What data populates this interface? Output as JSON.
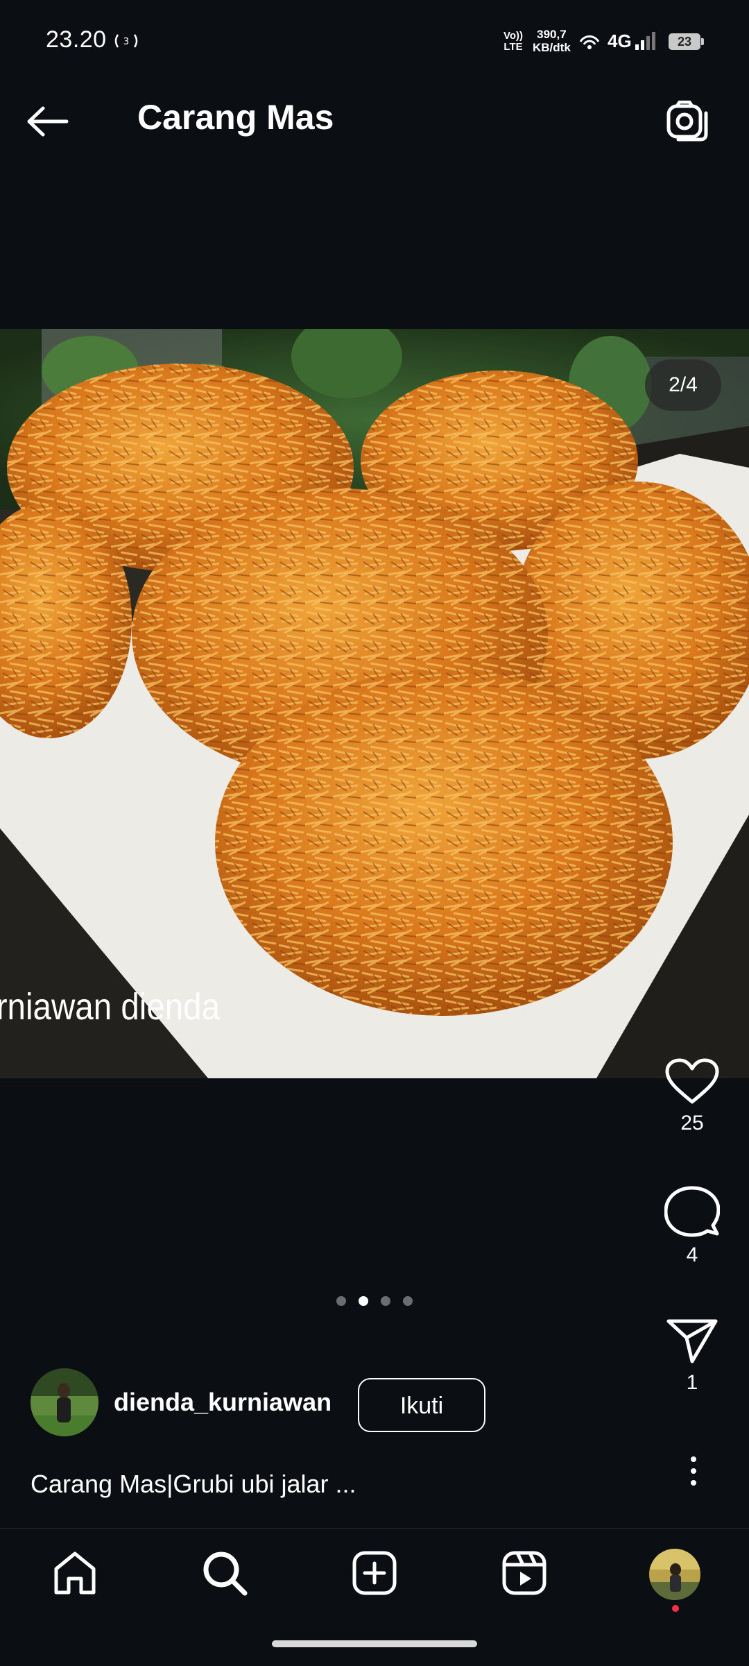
{
  "status_bar": {
    "time": "23.20",
    "volte_top": "Vo))",
    "volte_bottom": "LTE",
    "speed_value": "390,7",
    "speed_unit": "KB/dtk",
    "network": "4G",
    "battery": "23",
    "icons": [
      "hotspot-icon",
      "wifi-icon",
      "signal-icon",
      "battery-icon"
    ]
  },
  "header": {
    "title": "Carang Mas",
    "back_icon": "arrow-left-icon",
    "camera_icon": "camera-icon"
  },
  "post": {
    "counter": "2/4",
    "image_watermark": "rniawan dienda",
    "image_description_icon": "food-photo",
    "carousel_total": 4,
    "carousel_active": 2
  },
  "actions": {
    "likes": "25",
    "comments": "4",
    "shares": "1"
  },
  "author": {
    "username": "dienda_kurniawan",
    "follow_label": "Ikuti"
  },
  "caption": "Carang Mas|Grubi ubi jalar ...",
  "bottom_nav": [
    "home-icon",
    "search-icon",
    "create-icon",
    "reels-icon",
    "profile-avatar"
  ],
  "colors": {
    "background": "#0b0e13",
    "text": "#ffffff",
    "notification_dot": "#ff3040"
  }
}
